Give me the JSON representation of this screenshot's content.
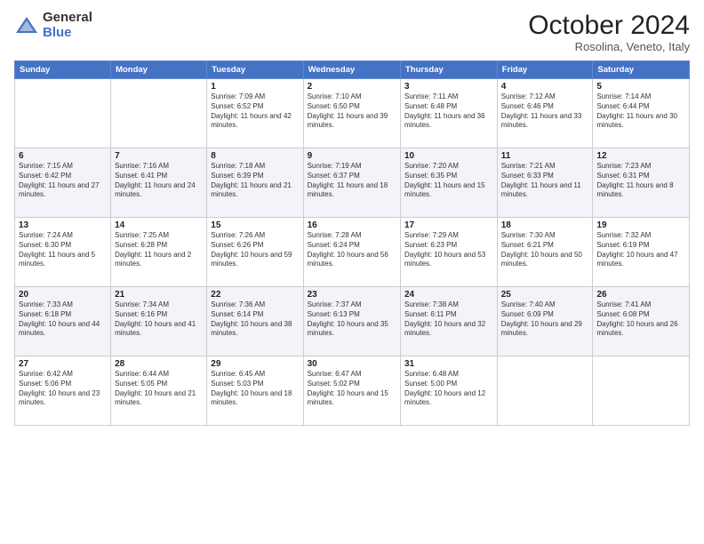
{
  "logo": {
    "general": "General",
    "blue": "Blue"
  },
  "title": "October 2024",
  "subtitle": "Rosolina, Veneto, Italy",
  "days_of_week": [
    "Sunday",
    "Monday",
    "Tuesday",
    "Wednesday",
    "Thursday",
    "Friday",
    "Saturday"
  ],
  "weeks": [
    [
      {
        "day": "",
        "info": ""
      },
      {
        "day": "",
        "info": ""
      },
      {
        "day": "1",
        "info": "Sunrise: 7:09 AM\nSunset: 6:52 PM\nDaylight: 11 hours and 42 minutes."
      },
      {
        "day": "2",
        "info": "Sunrise: 7:10 AM\nSunset: 6:50 PM\nDaylight: 11 hours and 39 minutes."
      },
      {
        "day": "3",
        "info": "Sunrise: 7:11 AM\nSunset: 6:48 PM\nDaylight: 11 hours and 36 minutes."
      },
      {
        "day": "4",
        "info": "Sunrise: 7:12 AM\nSunset: 6:46 PM\nDaylight: 11 hours and 33 minutes."
      },
      {
        "day": "5",
        "info": "Sunrise: 7:14 AM\nSunset: 6:44 PM\nDaylight: 11 hours and 30 minutes."
      }
    ],
    [
      {
        "day": "6",
        "info": "Sunrise: 7:15 AM\nSunset: 6:42 PM\nDaylight: 11 hours and 27 minutes."
      },
      {
        "day": "7",
        "info": "Sunrise: 7:16 AM\nSunset: 6:41 PM\nDaylight: 11 hours and 24 minutes."
      },
      {
        "day": "8",
        "info": "Sunrise: 7:18 AM\nSunset: 6:39 PM\nDaylight: 11 hours and 21 minutes."
      },
      {
        "day": "9",
        "info": "Sunrise: 7:19 AM\nSunset: 6:37 PM\nDaylight: 11 hours and 18 minutes."
      },
      {
        "day": "10",
        "info": "Sunrise: 7:20 AM\nSunset: 6:35 PM\nDaylight: 11 hours and 15 minutes."
      },
      {
        "day": "11",
        "info": "Sunrise: 7:21 AM\nSunset: 6:33 PM\nDaylight: 11 hours and 11 minutes."
      },
      {
        "day": "12",
        "info": "Sunrise: 7:23 AM\nSunset: 6:31 PM\nDaylight: 11 hours and 8 minutes."
      }
    ],
    [
      {
        "day": "13",
        "info": "Sunrise: 7:24 AM\nSunset: 6:30 PM\nDaylight: 11 hours and 5 minutes."
      },
      {
        "day": "14",
        "info": "Sunrise: 7:25 AM\nSunset: 6:28 PM\nDaylight: 11 hours and 2 minutes."
      },
      {
        "day": "15",
        "info": "Sunrise: 7:26 AM\nSunset: 6:26 PM\nDaylight: 10 hours and 59 minutes."
      },
      {
        "day": "16",
        "info": "Sunrise: 7:28 AM\nSunset: 6:24 PM\nDaylight: 10 hours and 56 minutes."
      },
      {
        "day": "17",
        "info": "Sunrise: 7:29 AM\nSunset: 6:23 PM\nDaylight: 10 hours and 53 minutes."
      },
      {
        "day": "18",
        "info": "Sunrise: 7:30 AM\nSunset: 6:21 PM\nDaylight: 10 hours and 50 minutes."
      },
      {
        "day": "19",
        "info": "Sunrise: 7:32 AM\nSunset: 6:19 PM\nDaylight: 10 hours and 47 minutes."
      }
    ],
    [
      {
        "day": "20",
        "info": "Sunrise: 7:33 AM\nSunset: 6:18 PM\nDaylight: 10 hours and 44 minutes."
      },
      {
        "day": "21",
        "info": "Sunrise: 7:34 AM\nSunset: 6:16 PM\nDaylight: 10 hours and 41 minutes."
      },
      {
        "day": "22",
        "info": "Sunrise: 7:36 AM\nSunset: 6:14 PM\nDaylight: 10 hours and 38 minutes."
      },
      {
        "day": "23",
        "info": "Sunrise: 7:37 AM\nSunset: 6:13 PM\nDaylight: 10 hours and 35 minutes."
      },
      {
        "day": "24",
        "info": "Sunrise: 7:38 AM\nSunset: 6:11 PM\nDaylight: 10 hours and 32 minutes."
      },
      {
        "day": "25",
        "info": "Sunrise: 7:40 AM\nSunset: 6:09 PM\nDaylight: 10 hours and 29 minutes."
      },
      {
        "day": "26",
        "info": "Sunrise: 7:41 AM\nSunset: 6:08 PM\nDaylight: 10 hours and 26 minutes."
      }
    ],
    [
      {
        "day": "27",
        "info": "Sunrise: 6:42 AM\nSunset: 5:06 PM\nDaylight: 10 hours and 23 minutes."
      },
      {
        "day": "28",
        "info": "Sunrise: 6:44 AM\nSunset: 5:05 PM\nDaylight: 10 hours and 21 minutes."
      },
      {
        "day": "29",
        "info": "Sunrise: 6:45 AM\nSunset: 5:03 PM\nDaylight: 10 hours and 18 minutes."
      },
      {
        "day": "30",
        "info": "Sunrise: 6:47 AM\nSunset: 5:02 PM\nDaylight: 10 hours and 15 minutes."
      },
      {
        "day": "31",
        "info": "Sunrise: 6:48 AM\nSunset: 5:00 PM\nDaylight: 10 hours and 12 minutes."
      },
      {
        "day": "",
        "info": ""
      },
      {
        "day": "",
        "info": ""
      }
    ]
  ]
}
